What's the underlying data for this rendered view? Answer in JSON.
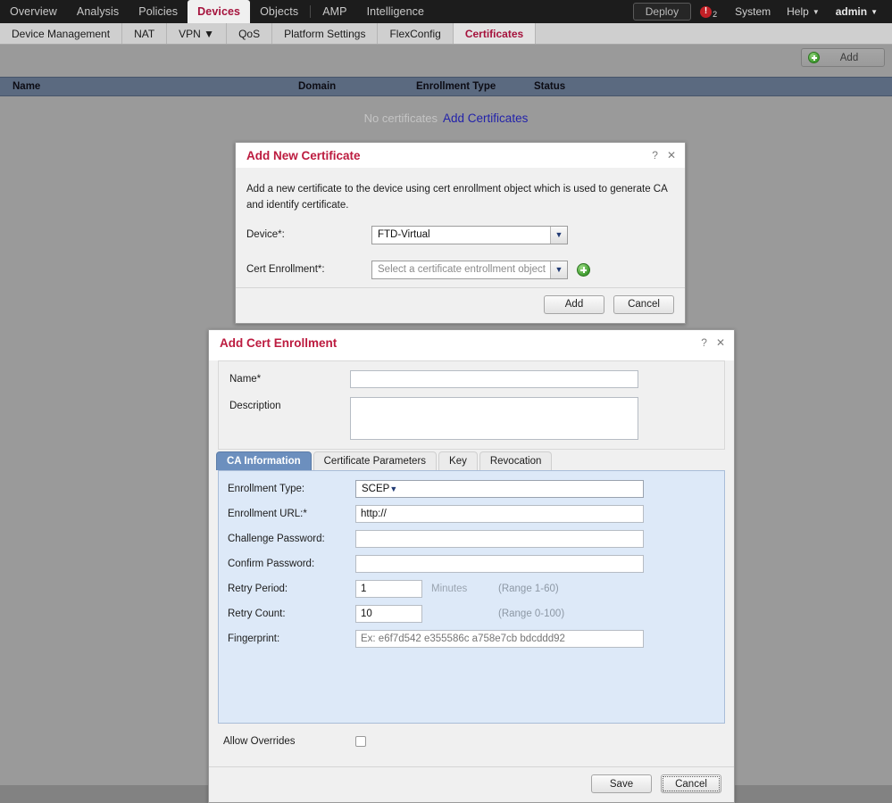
{
  "topnav": {
    "items": [
      {
        "label": "Overview",
        "active": false
      },
      {
        "label": "Analysis",
        "active": false
      },
      {
        "label": "Policies",
        "active": false
      },
      {
        "label": "Devices",
        "active": true
      },
      {
        "label": "Objects",
        "active": false
      },
      {
        "label": "AMP",
        "active": false
      },
      {
        "label": "Intelligence",
        "active": false
      }
    ],
    "deploy_label": "Deploy",
    "alert_icon": "alert-exclamation-icon",
    "alert_count": "2",
    "system_label": "System",
    "help_label": "Help",
    "help_caret": "▼",
    "user_label": "admin",
    "user_caret": "▼"
  },
  "subnav": {
    "items": [
      {
        "label": "Device Management",
        "active": false
      },
      {
        "label": "NAT",
        "active": false
      },
      {
        "label": "VPN ▼",
        "active": false
      },
      {
        "label": "QoS",
        "active": false
      },
      {
        "label": "Platform Settings",
        "active": false
      },
      {
        "label": "FlexConfig",
        "active": false
      },
      {
        "label": "Certificates",
        "active": true
      }
    ]
  },
  "toolbar": {
    "add_label": "Add",
    "add_icon": "green-plus-icon"
  },
  "table": {
    "columns": [
      "Name",
      "Domain",
      "Enrollment Type",
      "Status"
    ],
    "empty_text": "No certificates",
    "empty_link": "Add Certificates"
  },
  "dialog_new_cert": {
    "title": "Add New Certificate",
    "help_icon": "?",
    "close_icon": "✕",
    "description": "Add a new certificate to the device using cert enrollment object which is used to generate CA and identify certificate.",
    "device_label": "Device*:",
    "device_value": "FTD-Virtual",
    "cert_enrollment_label": "Cert Enrollment*:",
    "cert_enrollment_placeholder": "Select a certificate entrollment object",
    "add_enrollment_icon": "green-plus-circle-icon",
    "dropdown_icon": "chevron-down-icon",
    "add_button": "Add",
    "cancel_button": "Cancel"
  },
  "dialog_cert_enrollment": {
    "title": "Add Cert Enrollment",
    "help_icon": "?",
    "close_icon": "✕",
    "name_label": "Name*",
    "name_value": "",
    "description_label": "Description",
    "description_value": "",
    "tabs": [
      {
        "label": "CA Information",
        "active": true
      },
      {
        "label": "Certificate Parameters",
        "active": false
      },
      {
        "label": "Key",
        "active": false
      },
      {
        "label": "Revocation",
        "active": false
      }
    ],
    "fields": {
      "enrollment_type_label": "Enrollment Type:",
      "enrollment_type_value": "SCEP",
      "enrollment_url_label": "Enrollment URL:*",
      "enrollment_url_value": "http://",
      "challenge_password_label": "Challenge Password:",
      "challenge_password_value": "",
      "confirm_password_label": "Confirm Password:",
      "confirm_password_value": "",
      "retry_period_label": "Retry Period:",
      "retry_period_value": "1",
      "retry_period_unit": "Minutes",
      "retry_period_range": "(Range 1-60)",
      "retry_count_label": "Retry Count:",
      "retry_count_value": "10",
      "retry_count_range": "(Range 0-100)",
      "fingerprint_label": "Fingerprint:",
      "fingerprint_placeholder": "Ex: e6f7d542 e355586c a758e7cb bdcddd92",
      "dropdown_icon": "chevron-down-icon"
    },
    "allow_overrides_label": "Allow Overrides",
    "allow_overrides_checked": false,
    "save_button": "Save",
    "cancel_button": "Cancel"
  }
}
